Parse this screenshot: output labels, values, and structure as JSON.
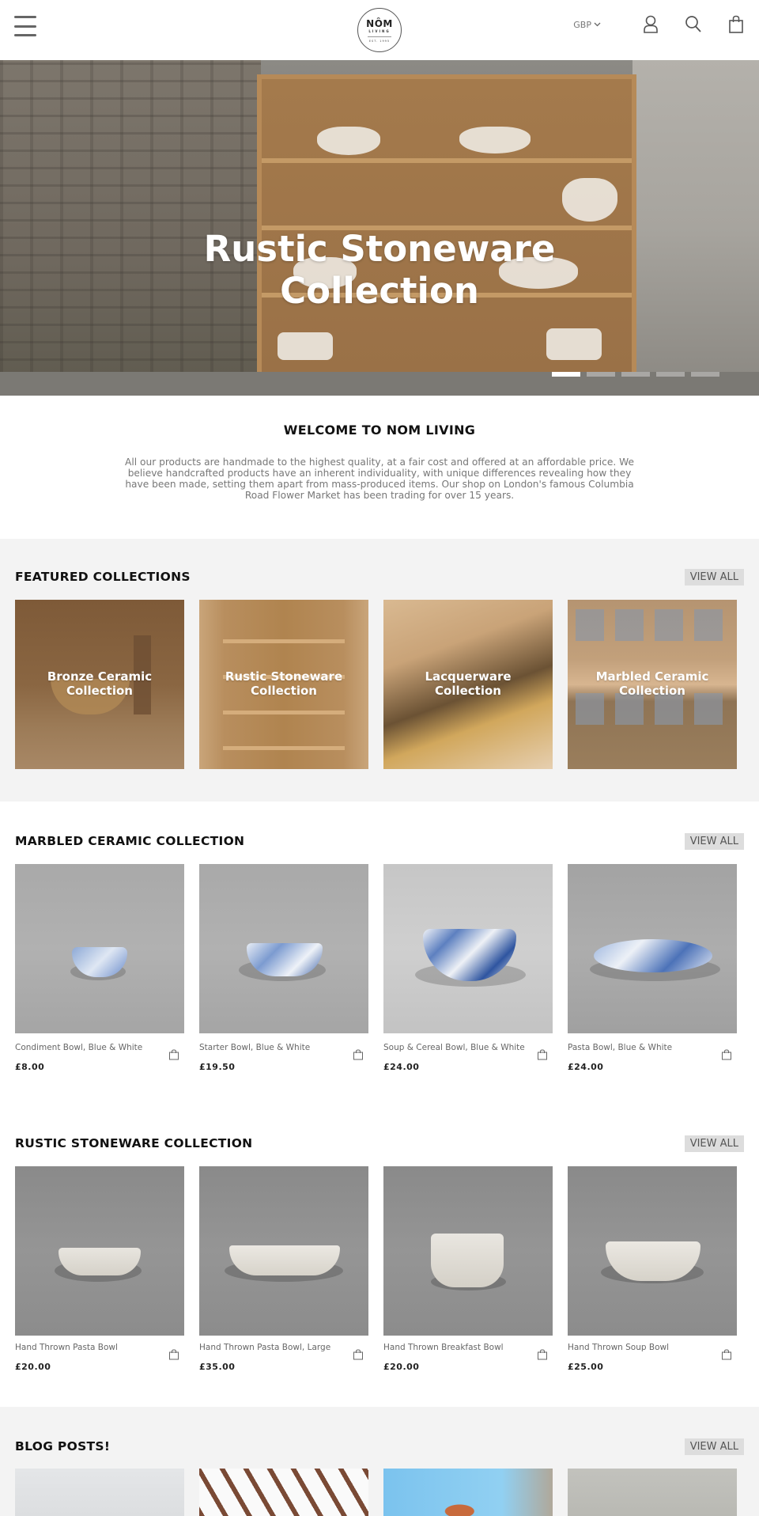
{
  "header": {
    "logo": {
      "line1": "NÔM",
      "line2": "LIVING",
      "line3": "EST. 1995"
    },
    "currency": "GBP",
    "icons": [
      "menu-icon",
      "account-icon",
      "search-icon",
      "cart-icon"
    ]
  },
  "hero": {
    "title_line1": "Rustic Stoneware",
    "title_line2": "Collection",
    "slide_count": 5,
    "active_slide": 1
  },
  "welcome": {
    "heading": "WELCOME TO NOM LIVING",
    "body": "All our products are handmade to the highest quality, at a fair cost and offered at an affordable price. We believe handcrafted products have an inherent individuality, with unique differences revealing how they have been made, setting them apart from mass-produced items. Our shop on London's famous Columbia Road Flower Market has been trading for over 15 years."
  },
  "featured": {
    "title": "FEATURED COLLECTIONS",
    "view_all": "VIEW ALL",
    "items": [
      {
        "line1": "Bronze Ceramic",
        "line2": "Collection"
      },
      {
        "line1": "Rustic Stoneware",
        "line2": "Collection"
      },
      {
        "line1": "Lacquerware",
        "line2": "Collection"
      },
      {
        "line1": "Marbled Ceramic",
        "line2": "Collection"
      }
    ]
  },
  "marbled": {
    "title": "MARBLED CERAMIC COLLECTION",
    "view_all": "VIEW ALL",
    "products": [
      {
        "name": "Condiment Bowl, Blue & White",
        "price": "£8.00"
      },
      {
        "name": "Starter Bowl, Blue & White",
        "price": "£19.50"
      },
      {
        "name": "Soup & Cereal Bowl, Blue & White",
        "price": "£24.00"
      },
      {
        "name": "Pasta Bowl, Blue & White",
        "price": "£24.00"
      }
    ]
  },
  "rustic": {
    "title": "RUSTIC STONEWARE COLLECTION",
    "view_all": "VIEW ALL",
    "products": [
      {
        "name": "Hand Thrown Pasta Bowl",
        "price": "£20.00"
      },
      {
        "name": "Hand Thrown Pasta Bowl, Large",
        "price": "£35.00"
      },
      {
        "name": "Hand Thrown Breakfast Bowl",
        "price": "£20.00"
      },
      {
        "name": "Hand Thrown Soup Bowl",
        "price": "£25.00"
      }
    ]
  },
  "blog": {
    "title": "BLOG POSTS!",
    "view_all": "VIEW ALL"
  },
  "colors": {
    "section_grey": "#f3f3f3",
    "view_all_bg": "#dddddd",
    "text_muted": "#777777"
  }
}
